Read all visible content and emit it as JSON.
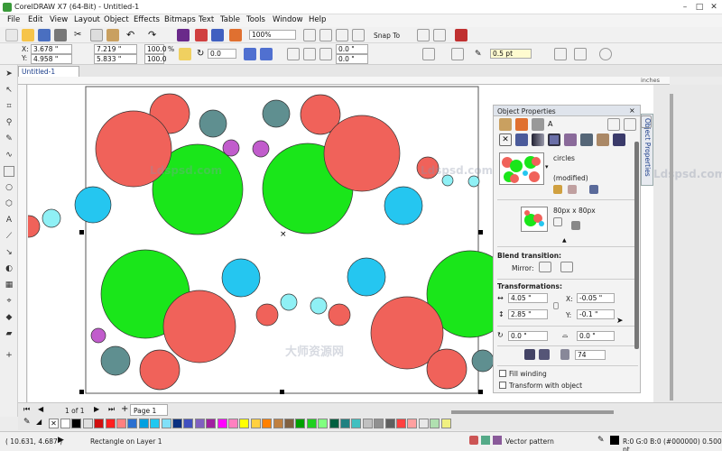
{
  "window": {
    "title": "CorelDRAW X7 (64-Bit) - Untitled-1"
  },
  "menu": [
    "File",
    "Edit",
    "View",
    "Layout",
    "Object",
    "Effects",
    "Bitmaps",
    "Text",
    "Table",
    "Tools",
    "Window",
    "Help"
  ],
  "standard_toolbar": {
    "zoom": "100%",
    "snap_to": "Snap To"
  },
  "property_bar": {
    "x": "3.678 \"",
    "y": "4.958 \"",
    "width": "7.219 \"",
    "height": "5.833 \"",
    "scale_w": "100.0",
    "scale_h": "100.0",
    "scale_unit": "%",
    "angle": "0.0",
    "corner1": "0.0 \"",
    "corner2": "0.0 \"",
    "outline": "0.5 pt"
  },
  "document_tab": "Untitled-1",
  "ruler": {
    "unit": "inches"
  },
  "docker": {
    "title": "Object Properties",
    "vertical_tab": "Object Properties",
    "pattern_name": "circles",
    "pattern_state": "(modified)",
    "tile_size": "80px x 80px",
    "blend_transition": "Blend transition:",
    "mirror": "Mirror:",
    "transformations": "Transformations:",
    "w_value": "4.05 \"",
    "x_label": "X:",
    "x_value": "-0.05 \"",
    "h_value": "2.85 \"",
    "y_label": "Y:",
    "y_value": "-0.1 \"",
    "rot_value": "0.0 \"",
    "skew_value": "0.0 \"",
    "count_value": "74",
    "fill_winding": "Fill winding",
    "transform_with_object": "Transform with object"
  },
  "page_nav": {
    "counter": "1 of 1",
    "page": "Page 1"
  },
  "status": {
    "coords": "( 10.631, 4.687 )",
    "selection": "Rectangle on Layer 1",
    "fill": "Vector pattern",
    "outline": "R:0 G:0 B:0 (#000000)  0.500 pt"
  },
  "watermarks": [
    "Ldspsd.com",
    "Ldspsd.com",
    "Ldspsd.com",
    "大师资源网"
  ],
  "colors": {
    "green": "#1ae61a",
    "red": "#f0625a",
    "cyan": "#25c6f0",
    "teal": "#5f8f90",
    "purple": "#c15ccc",
    "paleCyan": "#8ff0f5"
  },
  "palette": [
    "#ffffff",
    "#000000",
    "#e0e0e0",
    "#d01010",
    "#ff2020",
    "#ff8080",
    "#2a6fd0",
    "#00a0e0",
    "#20c8f0",
    "#80e0f8",
    "#0a3080",
    "#4050c0",
    "#8060c0",
    "#a020a0",
    "#ff00ff",
    "#ff80c0",
    "#ffff00",
    "#ffd040",
    "#ff8000",
    "#c08040",
    "#806040",
    "#00a000",
    "#20d020",
    "#80ff80",
    "#006040",
    "#208080",
    "#40c0c0",
    "#c0c0c0",
    "#909090",
    "#606060",
    "#ff4040",
    "#ffa0a0",
    "#e8e8e8",
    "#b0e0b0",
    "#f0f080"
  ]
}
